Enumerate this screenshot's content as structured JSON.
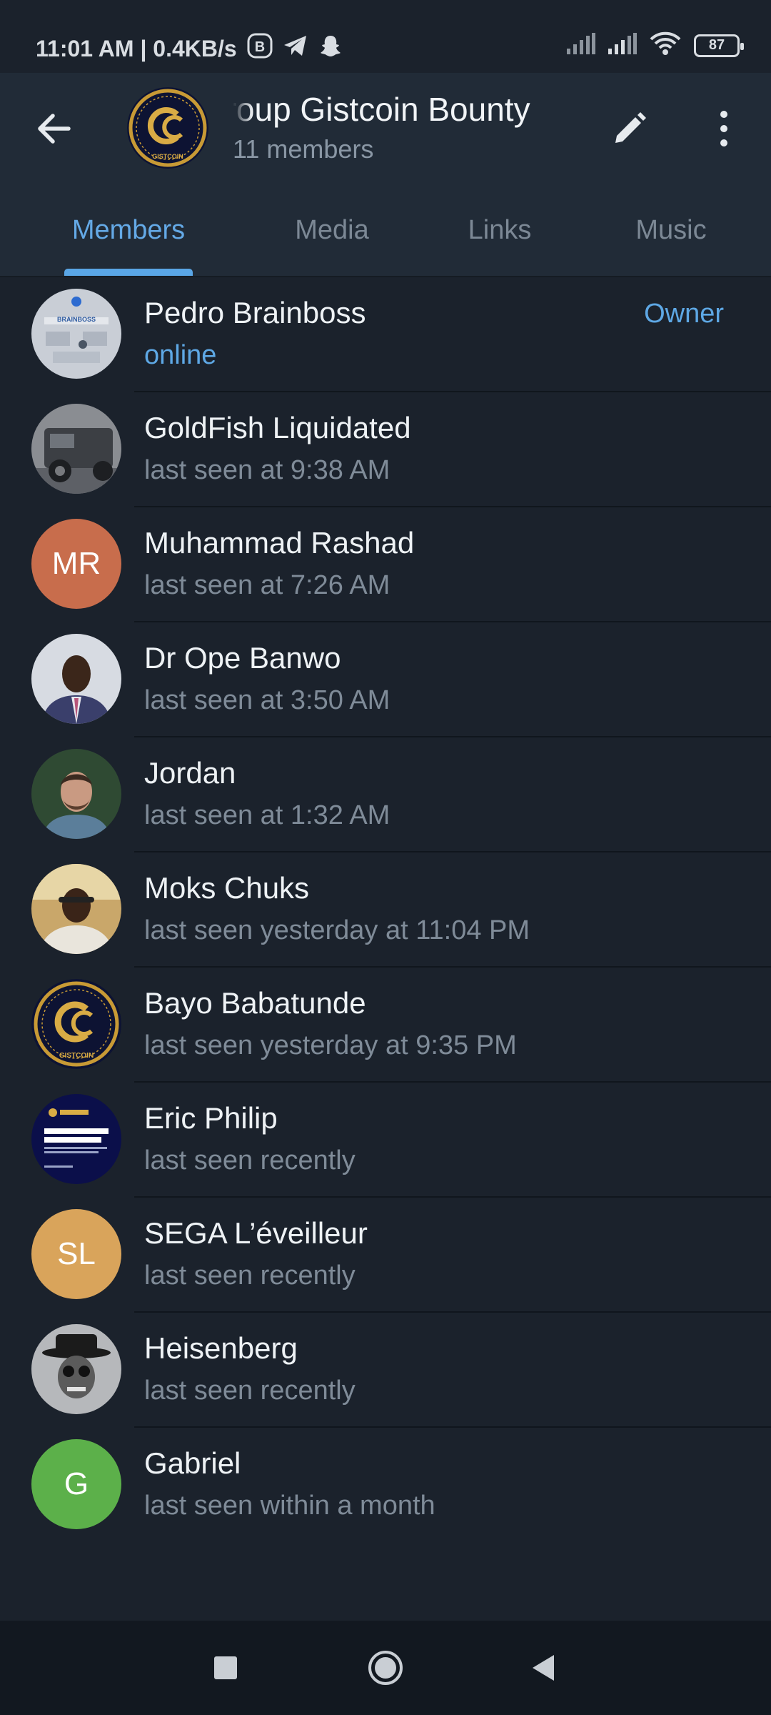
{
  "status_bar": {
    "time": "11:01 AM | 0.4KB/s",
    "battery": "87",
    "icons": [
      "b-app-icon",
      "telegram-icon",
      "snapchat-icon",
      "signal-icon",
      "signal-icon",
      "wifi-icon",
      "battery-icon"
    ]
  },
  "header": {
    "title": "group   Gistcoin Bounty",
    "subtitle": "11 members",
    "icons": [
      "back-arrow-icon",
      "group-avatar",
      "edit-pencil-icon",
      "more-vertical-icon"
    ]
  },
  "tabs": [
    {
      "label": "Members",
      "active": true
    },
    {
      "label": "Media",
      "active": false
    },
    {
      "label": "Links",
      "active": false
    },
    {
      "label": "Music",
      "active": false
    }
  ],
  "members": [
    {
      "name": "Pedro Brainboss",
      "status": "online",
      "role": "Owner",
      "avatar": "photo"
    },
    {
      "name": "GoldFish Liquidated",
      "status": "last seen at 9:38 AM",
      "role": "",
      "avatar": "photo"
    },
    {
      "name": "Muhammad Rashad",
      "status": "last seen at 7:26 AM",
      "role": "",
      "avatar": "MR"
    },
    {
      "name": "Dr Ope Banwo",
      "status": "last seen at 3:50 AM",
      "role": "",
      "avatar": "photo"
    },
    {
      "name": "Jordan",
      "status": "last seen at 1:32 AM",
      "role": "",
      "avatar": "photo"
    },
    {
      "name": "Moks Chuks",
      "status": "last seen yesterday at 11:04 PM",
      "role": "",
      "avatar": "photo"
    },
    {
      "name": "Bayo Babatunde",
      "status": "last seen yesterday at 9:35 PM",
      "role": "",
      "avatar": "gistcoin-logo"
    },
    {
      "name": "Eric Philip",
      "status": "last seen recently",
      "role": "",
      "avatar": "photo"
    },
    {
      "name": "SEGA L’éveilleur",
      "status": "last seen recently",
      "role": "",
      "avatar": "SL"
    },
    {
      "name": "Heisenberg",
      "status": "last seen recently",
      "role": "",
      "avatar": "photo"
    },
    {
      "name": "Gabriel",
      "status": "last seen within a month",
      "role": "",
      "avatar": "G"
    }
  ],
  "colors": {
    "background": "#1b222c",
    "header": "#212b37",
    "accent": "#5ea8e5",
    "avatar_mr": "#c86d4c",
    "avatar_sl": "#d9a45b",
    "avatar_g": "#5cb04a"
  },
  "nav_bar": {
    "icons": [
      "recents-square-icon",
      "home-circle-icon",
      "back-triangle-icon"
    ]
  }
}
